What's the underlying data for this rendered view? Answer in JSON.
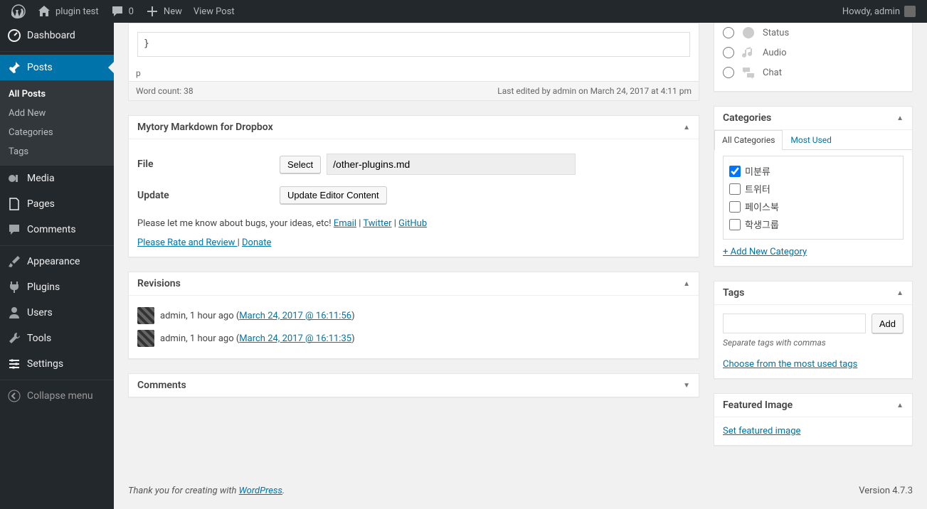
{
  "adminbar": {
    "site_name": "plugin test",
    "comments_count": "0",
    "new_label": "New",
    "view_post": "View Post",
    "howdy": "Howdy, admin"
  },
  "sidebar": {
    "dashboard": "Dashboard",
    "posts": "Posts",
    "posts_sub": {
      "all": "All Posts",
      "add": "Add New",
      "cats": "Categories",
      "tags": "Tags"
    },
    "media": "Media",
    "pages": "Pages",
    "comments": "Comments",
    "appearance": "Appearance",
    "plugins": "Plugins",
    "users": "Users",
    "tools": "Tools",
    "settings": "Settings",
    "collapse": "Collapse menu"
  },
  "editor": {
    "content_tail": "}",
    "path": "p",
    "wordcount": "Word count: 38",
    "last_edited": "Last edited by admin on March 24, 2017 at 4:11 pm"
  },
  "mytory": {
    "title": "Mytory Markdown for Dropbox",
    "file_label": "File",
    "select_btn": "Select",
    "file_value": "/other-plugins.md",
    "update_label": "Update",
    "update_btn": "Update Editor Content",
    "blurb": "Please let me know about bugs, your ideas, etc! ",
    "email": "Email",
    "twitter": "Twitter",
    "github": "GitHub",
    "rate": "Please Rate and Review ",
    "donate": "Donate"
  },
  "revisions": {
    "title": "Revisions",
    "items": [
      {
        "by": "admin, 1 hour ago (",
        "ts": "March 24, 2017 @ 16:11:56",
        "close": ")"
      },
      {
        "by": "admin, 1 hour ago (",
        "ts": "March 24, 2017 @ 16:11:35",
        "close": ")"
      }
    ]
  },
  "comments_box": {
    "title": "Comments"
  },
  "formats": {
    "status": "Status",
    "audio": "Audio",
    "chat": "Chat"
  },
  "categories": {
    "title": "Categories",
    "tab_all": "All Categories",
    "tab_most": "Most Used",
    "items": [
      "미분류",
      "트위터",
      "페이스북",
      "학생그룹"
    ],
    "add_new": "+ Add New Category"
  },
  "tags": {
    "title": "Tags",
    "add_btn": "Add",
    "hint": "Separate tags with commas",
    "choose": "Choose from the most used tags"
  },
  "featured": {
    "title": "Featured Image",
    "set": "Set featured image"
  },
  "footer": {
    "thanks_pre": "Thank you for creating with ",
    "wp": "WordPress",
    "version": "Version 4.7.3"
  }
}
